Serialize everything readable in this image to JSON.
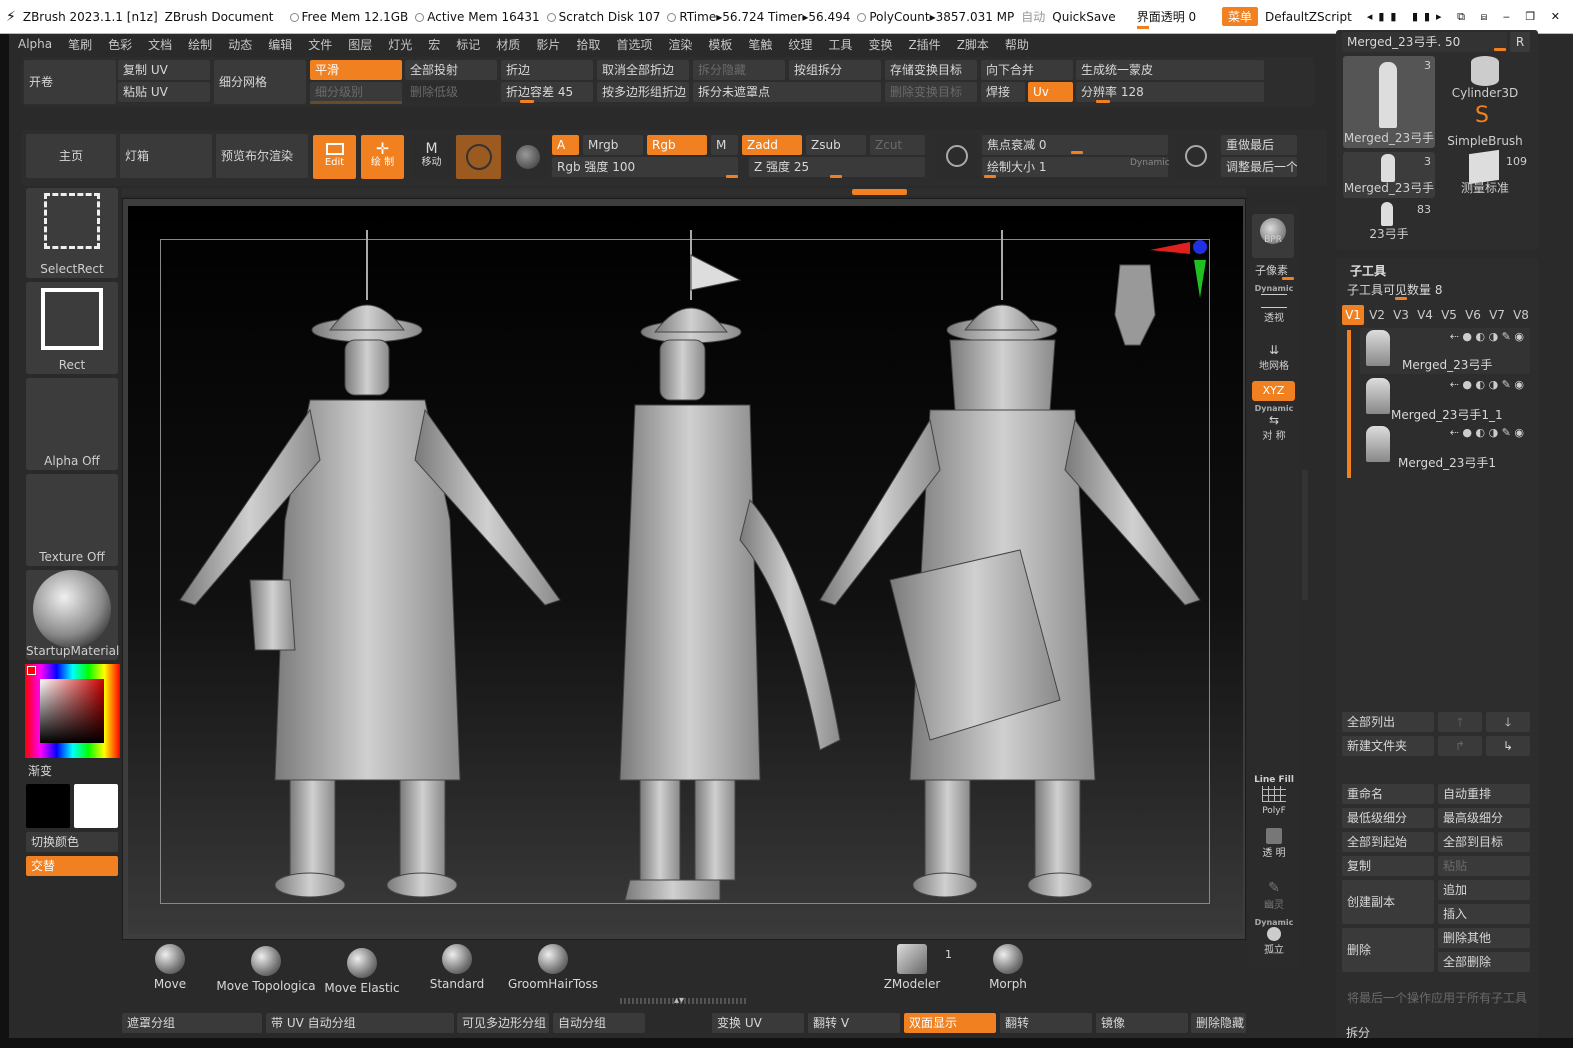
{
  "titlebar": {
    "app": "ZBrush 2023.1.1 [n1z]",
    "doc": "ZBrush Document",
    "free_mem": "Free Mem 12.1GB",
    "active_mem": "Active Mem 16431",
    "scratch": "Scratch Disk 107",
    "rtime": "RTime▸56.724 Timer▸56.494",
    "polycount": "PolyCount▸3857.031 MP",
    "auto": "自动",
    "quicksave": "QuickSave",
    "transparency": "界面透明 0",
    "menu": "菜单",
    "script": "DefaultZScript"
  },
  "menu": [
    "Alpha",
    "笔刷",
    "色彩",
    "文档",
    "绘制",
    "动态",
    "编辑",
    "文件",
    "图层",
    "灯光",
    "宏",
    "标记",
    "材质",
    "影片",
    "拾取",
    "首选项",
    "渲染",
    "模板",
    "笔触",
    "纹理",
    "工具",
    "变换",
    "Z插件",
    "Z脚本",
    "帮助"
  ],
  "topbar": {
    "open": "开卷",
    "copy_uv": "复制 UV",
    "paste_uv": "粘贴 UV",
    "subdiv_mesh": "细分网格",
    "smooth": "平滑",
    "subdiv_level": "细分级别",
    "project_all": "全部投射",
    "del_lower": "删除低级",
    "crease": "折边",
    "crease_tol": "折边容差 45",
    "uncrease_all": "取消全部折边",
    "crease_pg": "按多边形组折边",
    "split_hidden": "拆分隐藏",
    "split_unmasked": "拆分未遮罩点",
    "groups_split": "按组拆分",
    "store_morph": "存储变换目标",
    "del_morph": "删除变换目标",
    "merge_down": "向下合并",
    "weld": "焊接",
    "uv": "Uv",
    "unified_skin": "生成统一蒙皮",
    "resolution": "分辨率 128"
  },
  "toolbar2": {
    "home": "主页",
    "lightbox": "灯箱",
    "bpr_preview": "预览布尔渲染",
    "edit": "Edit",
    "draw": "绘 制",
    "move": "移动",
    "a": "A",
    "mrgb": "Mrgb",
    "rgb": "Rgb",
    "m": "M",
    "zadd": "Zadd",
    "zsub": "Zsub",
    "zcut": "Zcut",
    "rgb_intensity": "Rgb 强度 100",
    "z_intensity": "Z 强度 25",
    "focal_shift": "焦点衰减 0",
    "draw_size": "绘制大小 1",
    "dynamic": "Dynamic",
    "redo_last": "重做最后",
    "adjust_last": "调整最后一个"
  },
  "left": {
    "select_rect": "SelectRect",
    "rect": "Rect",
    "alpha_off": "Alpha Off",
    "texture_off": "Texture Off",
    "material": "StartupMaterial",
    "gradient": "渐变",
    "switch_color": "切换颜色",
    "alternate": "交替"
  },
  "rightbar": {
    "bpr": "BPR",
    "subpixel": "子像素",
    "persp": "透视",
    "floor": "地网格",
    "xyz": "XYZ",
    "dynamic": "Dynamic",
    "sym": "对 称",
    "linefill": "Line Fill",
    "polyf": "PolyF",
    "transp": "透 明",
    "ghost": "幽灵",
    "solo": "孤立"
  },
  "tools": {
    "current": "Merged_23弓手. 50",
    "r": "R",
    "items": [
      {
        "label": "Merged_23弓手",
        "count": "3"
      },
      {
        "label": "Cylinder3D",
        "count": ""
      },
      {
        "label": "SimpleBrush",
        "count": ""
      },
      {
        "label": "Merged_23弓手",
        "count": "3"
      },
      {
        "label": "测量标准",
        "count": "109"
      },
      {
        "label": "23弓手",
        "count": "83"
      }
    ]
  },
  "subtool": {
    "title": "子工具",
    "visible_count": "子工具可见数量 8",
    "versions": [
      "V1",
      "V2",
      "V3",
      "V4",
      "V5",
      "V6",
      "V7",
      "V8"
    ],
    "items": [
      "Merged_23弓手",
      "Merged_23弓手1_1",
      "Merged_23弓手1"
    ],
    "list_all": "全部列出",
    "new_folder": "新建文件夹",
    "rename": "重命名",
    "auto_reorder": "自动重排",
    "lowest_subdiv": "最低级细分",
    "highest_subdiv": "最高级细分",
    "all_to_start": "全部到起始",
    "all_to_target": "全部到目标",
    "copy": "复制",
    "paste": "粘贴",
    "duplicate": "创建副本",
    "append": "追加",
    "insert": "插入",
    "delete": "删除",
    "delete_other": "删除其他",
    "delete_all": "全部删除",
    "apply_all": "将最后一个操作应用于所有子工具",
    "split": "拆分"
  },
  "shelf": {
    "brushes": [
      "Move",
      "Move Topologica",
      "Move Elastic",
      "Standard",
      "GroomHairToss"
    ],
    "zmodeler": "ZModeler",
    "zmodeler_count": "1",
    "morph": "Morph"
  },
  "bottom": {
    "mask_group": "遮罩分组",
    "uv_autogroup": "带 UV 自动分组",
    "visible_pg": "可见多边形分组",
    "autogroup": "自动分组",
    "flip_uv": "变换 UV",
    "flip_v": "翻转 V",
    "double": "双面显示",
    "flip": "翻转",
    "mirror": "镜像",
    "del_hidden": "删除隐藏"
  }
}
